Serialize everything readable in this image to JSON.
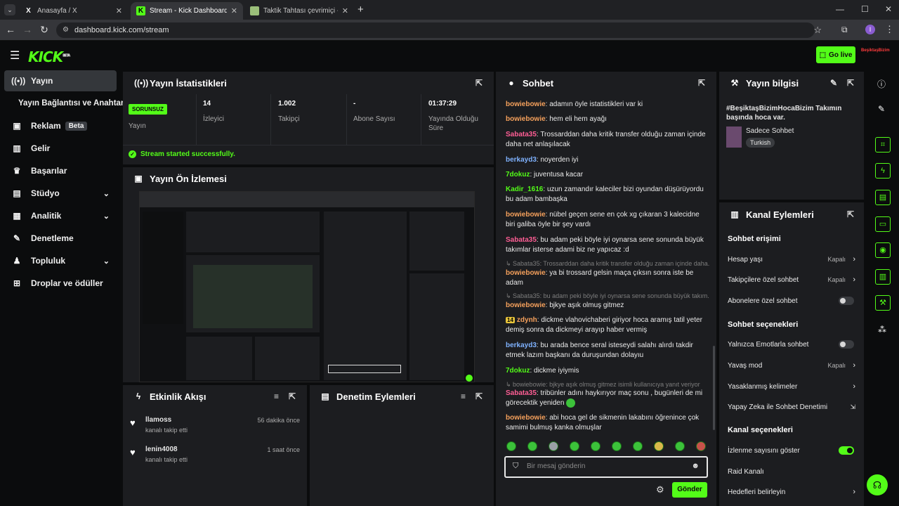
{
  "browser": {
    "tabs": [
      {
        "title": "Anasayfa / X",
        "icon": "x-logo-icon"
      },
      {
        "title": "Stream - Kick Dashboard",
        "icon": "kick-logo-icon"
      },
      {
        "title": "Taktik Tahtası çevrimiçi - Futbol",
        "icon": "board-icon"
      }
    ],
    "new_tab": "+",
    "url": "dashboard.kick.com/stream",
    "profile_initial": "I"
  },
  "header": {
    "logo": "KICK",
    "logo_sup": "BETA",
    "go_live": "Go live",
    "channel_logo": "BeşiktaşBizim"
  },
  "sidebar": {
    "items": [
      {
        "label": "Yayın",
        "icon": "broadcast-icon"
      },
      {
        "label": "Yayın Bağlantısı ve Anahtarı",
        "icon": ""
      },
      {
        "label": "Reklam",
        "badge": "Beta",
        "icon": "ad-icon"
      },
      {
        "label": "Gelir",
        "icon": "revenue-icon"
      },
      {
        "label": "Başarılar",
        "icon": "trophy-icon"
      },
      {
        "label": "Stüdyo",
        "icon": "studio-icon"
      },
      {
        "label": "Analitik",
        "icon": "analytics-icon"
      },
      {
        "label": "Denetleme",
        "icon": "moderation-icon"
      },
      {
        "label": "Topluluk",
        "icon": "community-icon"
      },
      {
        "label": "Droplar ve ödüller",
        "icon": "gift-icon"
      }
    ]
  },
  "stats": {
    "title": "Yayın İstatistikleri",
    "status_badge": "SORUNSUZ",
    "status_label": "Yayın",
    "viewers": "14",
    "viewers_label": "İzleyici",
    "followers": "1.002",
    "followers_label": "Takipçi",
    "subs": "-",
    "subs_label": "Abone Sayısı",
    "duration": "01:37:29",
    "duration_label": "Yayında Olduğu Süre",
    "success": "Stream started successfully."
  },
  "preview": {
    "title": "Yayın Ön İzlemesi"
  },
  "activity": {
    "title": "Etkinlik Akışı",
    "items": [
      {
        "user": "llamoss",
        "action": "kanalı takip etti",
        "time": "56 dakika önce"
      },
      {
        "user": "lenin4008",
        "action": "kanalı takip etti",
        "time": "1 saat önce"
      }
    ]
  },
  "moderation": {
    "title": "Denetim Eylemleri"
  },
  "chat": {
    "title": "Sohbet",
    "messages": [
      {
        "user": "bowiebowie",
        "color": "#f6a15c",
        "text": "adamın öyle istatistikleri var ki"
      },
      {
        "user": "bowiebowie",
        "color": "#f6a15c",
        "text": "hem eli hem ayağı"
      },
      {
        "user": "Sabata35",
        "color": "#ff5e95",
        "text": "Trossarddan daha kritik transfer olduğu zaman içinde daha net anlaşılacak"
      },
      {
        "user": "berkayd3",
        "color": "#7fb2ff",
        "text": "noyerden iyi"
      },
      {
        "user": "7dokuz",
        "color": "#53fc18",
        "text": "juventusa kacar"
      },
      {
        "user": "Kadir_1616",
        "color": "#53fc18",
        "text": "uzun zamandır kaleciler bizi oyundan düşürüyordu bu adam bambaşka"
      },
      {
        "user": "bowiebowie",
        "color": "#f6a15c",
        "text": "nübel geçen sene en çok xg çıkaran 3 kalecidne biri galiba öyle bir şey vardı"
      },
      {
        "user": "Sabata35",
        "color": "#ff5e95",
        "text": "bu adam peki böyle iyi oynarsa sene sonunda büyük takımlar isterse adami biz ne yapıcaz :d"
      },
      {
        "reply": "Sabata35: Trossarddan daha kritik transfer olduğu zaman içinde daha..."
      },
      {
        "user": "bowiebowie",
        "color": "#f6a15c",
        "text": "ya bi trossard gelsin maça çıksın sonra iste be adam"
      },
      {
        "reply": "Sabata35: bu adam peki böyle iyi oynarsa sene sonunda büyük takım..."
      },
      {
        "user": "bowiebowie",
        "color": "#f6a15c",
        "text": "bjkye aşık olmuş gitmez"
      },
      {
        "user": "zdynh",
        "badge": "14",
        "color": "#f6a15c",
        "text": "dickme vlahovichaberi giriyor hoca aramış tatil yeter demiş sonra da dickmeyi arayıp haber vermiş"
      },
      {
        "user": "berkayd3",
        "color": "#7fb2ff",
        "text": "bu arada bence seral isteseydi salahı alırdı takdir etmek lazım başkanı da duruşundan dolayıu"
      },
      {
        "user": "7dokuz",
        "color": "#53fc18",
        "text": "dickme iyiymis"
      },
      {
        "reply": "bowiebowie: bjkye aşık olmuş gitmez isimli kullanıcıya yanıt veriyor"
      },
      {
        "user": "Sabata35",
        "color": "#ff5e95",
        "text": "tribünler adını haykırıyor maç sonu , bugünleri de mi görecektik yeniden"
      },
      {
        "user": "bowiebowie",
        "color": "#f6a15c",
        "text": "abi hoca gel de sikmenin lakabını öğrenince çok samimi bulmuş kanka olmuşlar"
      }
    ],
    "placeholder": "Bir mesaj gönderin",
    "send": "Gönder"
  },
  "stream_info": {
    "title": "Yayın bilgisi",
    "stream_title": "#BeşiktaşBizimHocaBizim Takımın başında hoca var.",
    "category": "Sadece Sohbet",
    "language": "Turkish"
  },
  "channel_actions": {
    "title": "Kanal Eylemleri",
    "chat_access": "Sohbet erişimi",
    "account_age": "Hesap yaşı",
    "account_age_val": "Kapalı",
    "followers_only": "Takipçilere özel sohbet",
    "followers_only_val": "Kapalı",
    "subs_only": "Abonelere özel sohbet",
    "chat_options": "Sohbet seçenekleri",
    "emotes_only": "Yalnızca Emotlarla sohbet",
    "slow_mode": "Yavaş mod",
    "slow_mode_val": "Kapalı",
    "banned_words": "Yasaklanmış kelimeler",
    "ai_mod": "Yapay Zeka ile Sohbet Denetimi",
    "channel_options": "Kanal seçenekleri",
    "show_viewers": "İzlenme sayısını göster",
    "raid": "Raid Kanalı",
    "goals": "Hedefleri belirleyin"
  },
  "colors": {
    "accent": "#53fc18",
    "panel": "#1c1d20",
    "bg": "#0b0c0d"
  }
}
